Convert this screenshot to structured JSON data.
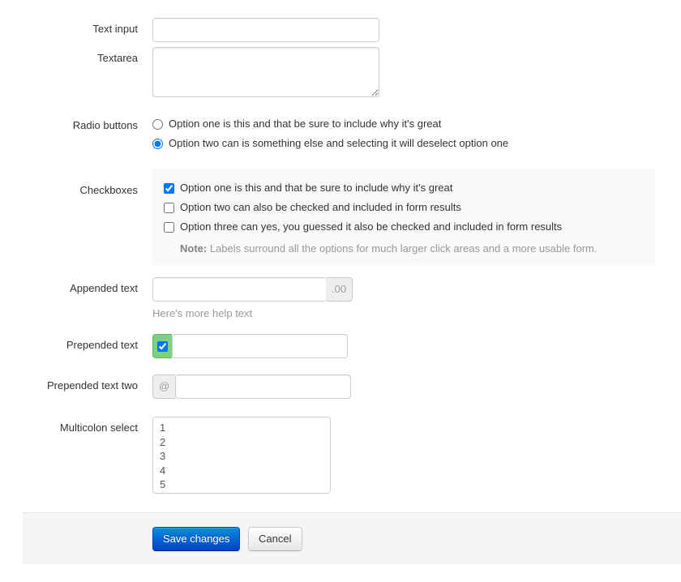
{
  "form": {
    "fields": [
      {
        "id": "text-input",
        "label": "Text input",
        "type": "text",
        "value": "",
        "placeholder": ""
      },
      {
        "id": "textarea",
        "label": "Textarea",
        "type": "textarea",
        "value": "",
        "placeholder": ""
      },
      {
        "id": "radio-buttons",
        "label": "Radio buttons",
        "type": "radio",
        "options": [
          {
            "label": "Option one is this and that be sure to include why it's great",
            "checked": false
          },
          {
            "label": "Option two can is something else and selecting it will deselect option one",
            "checked": true
          }
        ]
      },
      {
        "id": "checkboxes",
        "label": "Checkboxes",
        "type": "checkbox",
        "options": [
          {
            "label": "Option one is this and that be sure to include why it's great",
            "checked": true
          },
          {
            "label": "Option two can also be checked and included in form results",
            "checked": false
          },
          {
            "label": "Option three can yes, you guessed it also be checked and included in form results",
            "checked": false
          }
        ],
        "note_prefix": "Note:",
        "note_text": " Labels surround all the options for much larger click areas and a more usable form."
      },
      {
        "id": "appended-text",
        "label": "Appended text",
        "type": "append",
        "value": "",
        "addon": ".00",
        "help": "Here's more help text"
      },
      {
        "id": "prepended-text",
        "label": "Prepended text",
        "type": "prepend-checkbox",
        "value": "",
        "addon_checked": true
      },
      {
        "id": "prepended-text-two",
        "label": "Prepended text two",
        "type": "prepend",
        "value": "",
        "addon": "@"
      },
      {
        "id": "multicolon-select",
        "label": "Multicolon select",
        "type": "multiselect",
        "options": [
          "1",
          "2",
          "3",
          "4",
          "5"
        ]
      }
    ]
  },
  "actions": {
    "save_label": "Save changes",
    "cancel_label": "Cancel"
  },
  "colors": {
    "primary": "#0062cc",
    "addon_green": "#7fd07f",
    "well_background": "#f9f9f9",
    "footer_background": "#f5f5f5",
    "muted_text": "#999999"
  }
}
